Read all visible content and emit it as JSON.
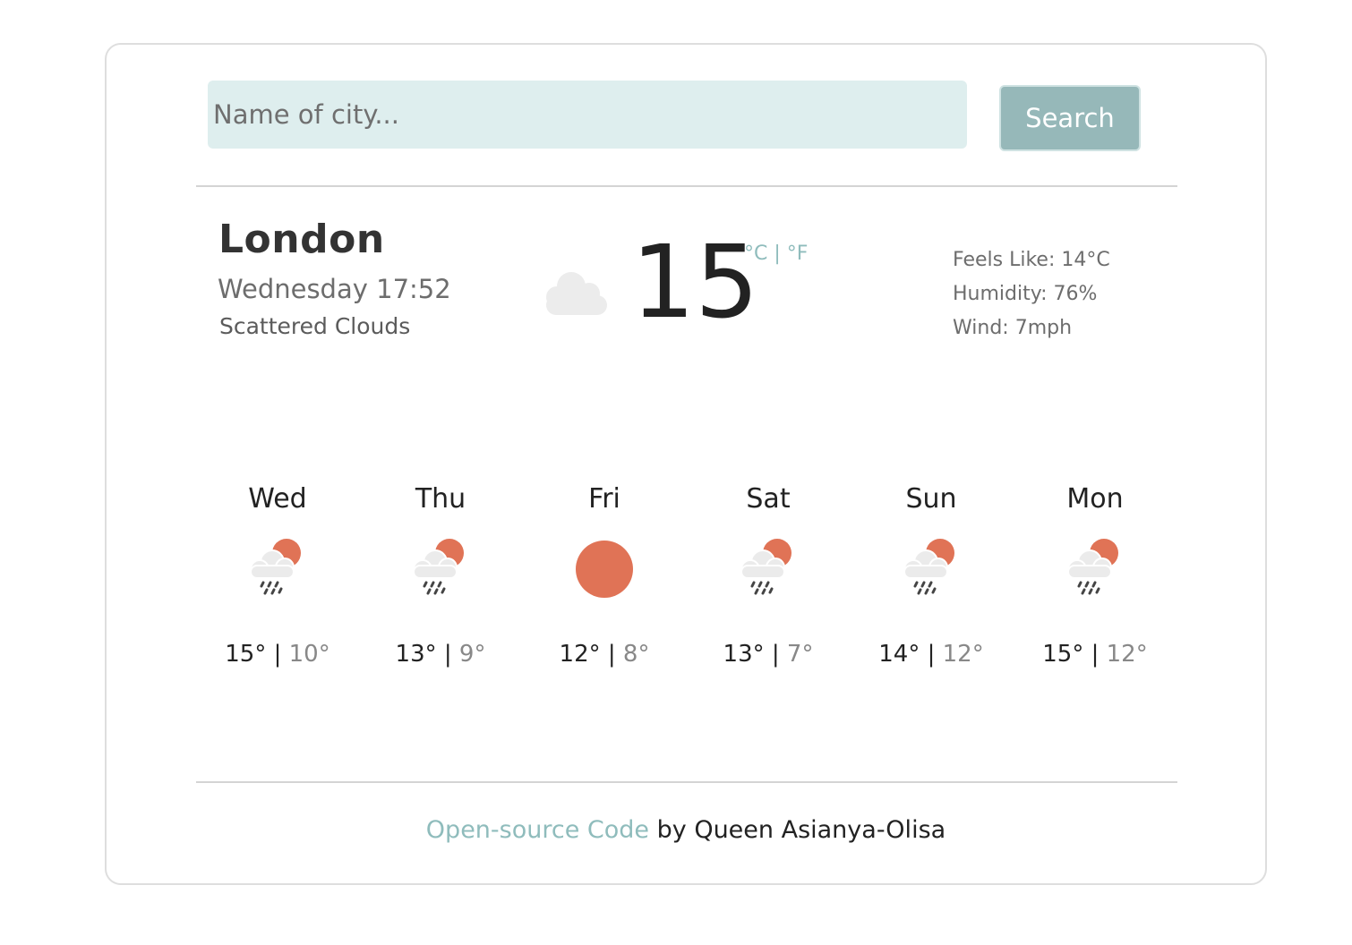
{
  "search": {
    "placeholder": "Name of city...",
    "button_label": "Search"
  },
  "current": {
    "city": "London",
    "datetime": "Wednesday 17:52",
    "description": "Scattered Clouds",
    "temperature": "15",
    "unit_celsius": "°C",
    "unit_separator": "|",
    "unit_fahrenheit": "°F",
    "icon": "cloud-icon",
    "feels_like": "Feels Like: 14°C",
    "humidity": "Humidity: 76%",
    "wind": "Wind: 7mph"
  },
  "forecast": [
    {
      "day": "Wed",
      "icon": "sun-cloud-rain-icon",
      "high": "15°",
      "separator": "|",
      "low": "10°"
    },
    {
      "day": "Thu",
      "icon": "sun-cloud-rain-icon",
      "high": "13°",
      "separator": "|",
      "low": "9°"
    },
    {
      "day": "Fri",
      "icon": "sun-icon",
      "high": "12°",
      "separator": "|",
      "low": "8°"
    },
    {
      "day": "Sat",
      "icon": "sun-cloud-rain-icon",
      "high": "13°",
      "separator": "|",
      "low": "7°"
    },
    {
      "day": "Sun",
      "icon": "sun-cloud-rain-icon",
      "high": "14°",
      "separator": "|",
      "low": "12°"
    },
    {
      "day": "Mon",
      "icon": "sun-cloud-rain-icon",
      "high": "15°",
      "separator": "|",
      "low": "12°"
    }
  ],
  "footer": {
    "link_text": "Open-source Code",
    "suffix": " by Queen Asianya-Olisa"
  },
  "colors": {
    "accent": "#96b8b9",
    "input_bg": "#deeeee",
    "sun": "#e07356",
    "cloud": "#ececec"
  }
}
